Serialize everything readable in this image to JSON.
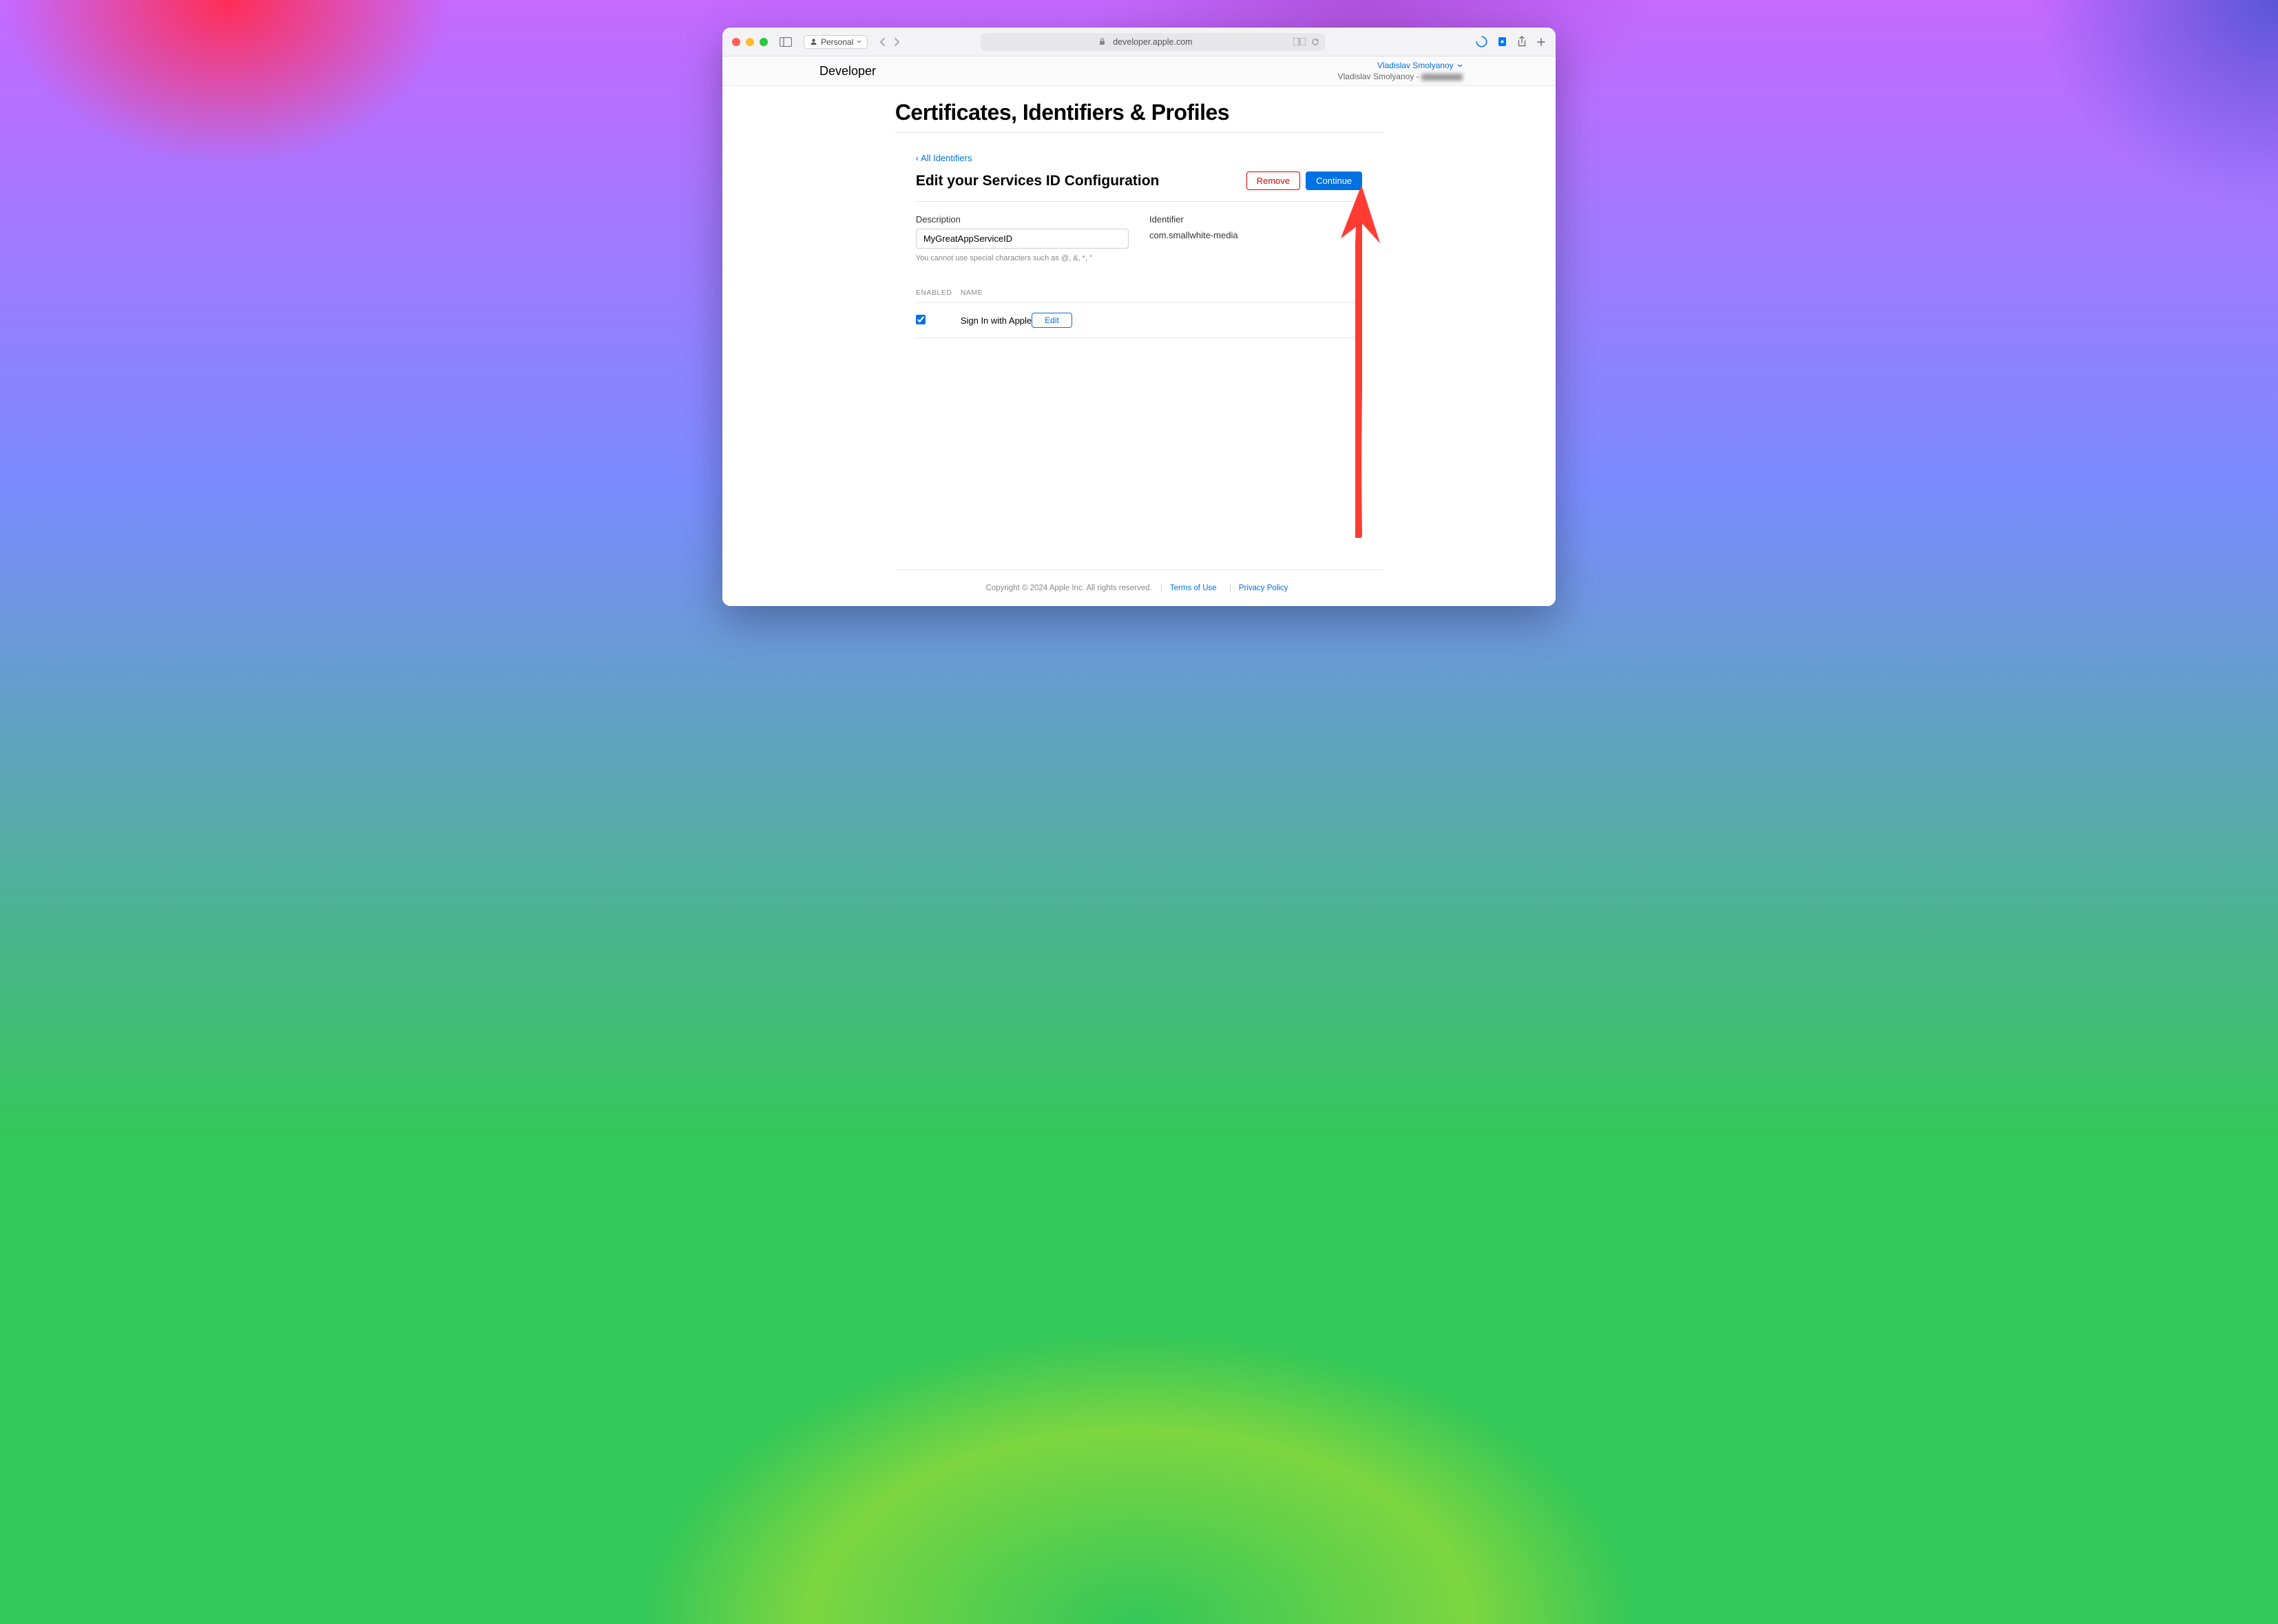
{
  "browser": {
    "profile_label": "Personal",
    "address": "developer.apple.com"
  },
  "dev_header": {
    "brand": "Developer",
    "user_link": "Vladislav Smolyanoy",
    "team_prefix": "Vladislav Smolyanoy -"
  },
  "page": {
    "title": "Certificates, Identifiers & Profiles",
    "back_link": "‹ All Identifiers",
    "section_title": "Edit your Services ID Configuration",
    "remove_btn": "Remove",
    "continue_btn": "Continue"
  },
  "fields": {
    "description_label": "Description",
    "description_value": "MyGreatAppServiceID",
    "description_hint": "You cannot use special characters such as @, &, *, \"",
    "identifier_label": "Identifier",
    "identifier_value": "com.smallwhite-media"
  },
  "capabilities": {
    "col_enabled": "ENABLED",
    "col_name": "NAME",
    "row_name": "Sign In with Apple",
    "edit_btn": "Edit"
  },
  "footer": {
    "copyright": "Copyright © 2024 Apple Inc. All rights reserved.",
    "terms": "Terms of Use",
    "privacy": "Privacy Policy"
  }
}
